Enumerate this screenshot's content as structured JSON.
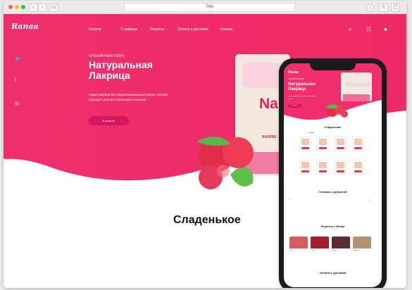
{
  "window": {
    "title": "Title"
  },
  "browser": {
    "nav_icons": [
      "back-icon",
      "forward-icon",
      "sidebar-icon"
    ],
    "actions": [
      "download-icon",
      "share-icon",
      "tabs-icon"
    ]
  },
  "site": {
    "logo": "Ranaa",
    "nav": [
      "Каталог",
      "О лакрице",
      "Рецепты",
      "Оплата и доставка",
      "Отзывы"
    ],
    "social": [
      "twitter-icon",
      "facebook-icon",
      "instagram-icon"
    ],
    "header_icons": [
      "search-icon",
      "cart-icon",
      "user-icon"
    ],
    "hero": {
      "eyebrow": "ОНЛАЙН-МАГАЗИН",
      "title_line1": "Натуральная",
      "title_line2": "Лакрица",
      "description": "Наша лакрица без гидрогенизованных жиров, потому подходит для вегетарианцев и веганов",
      "button": "В каталог"
    },
    "product": {
      "label": "Na",
      "note": "RASPBE"
    },
    "section_title": "Сладенькое",
    "colors": {
      "pink": "#ef2e6b",
      "deep_pink": "#d5175f",
      "white": "#ffffff"
    }
  },
  "mobile": {
    "eyebrow": "ОНЛАЙН-МАГАЗИН",
    "title": "Натуральная Лакрица",
    "description": "Наша лакрица без гидрогенизованных жиров",
    "button": "В каталог",
    "section_sweets": "Сладенькое",
    "section_cook": "Готовим с добротой",
    "section_recipes": "Рецепты с Ranaa",
    "section_delivery": "Оплата и доставка"
  }
}
